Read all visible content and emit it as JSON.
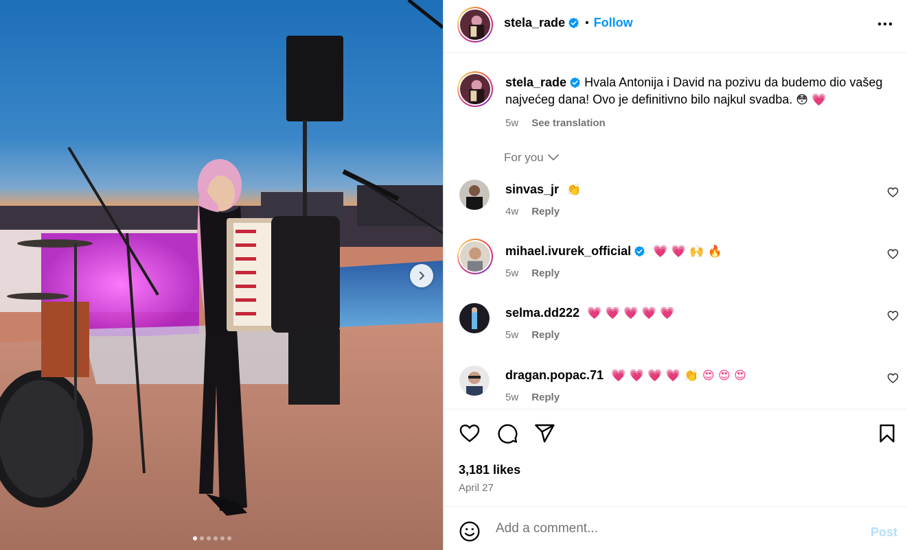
{
  "post": {
    "author": "stela_rade",
    "follow_label": "Follow",
    "separator": "•",
    "caption": "Hvala Antonija i David na pozivu da budemo dio vašeg najvećeg dana! Ovo je definitivno bilo najkul svadba.",
    "caption_emojis": "😳 💗",
    "caption_age": "5w",
    "see_translation": "See translation",
    "for_you": "For you",
    "likes": "3,181 likes",
    "date": "April 27",
    "carousel": {
      "slide_count": 6,
      "active_index": 0
    }
  },
  "comments": [
    {
      "user": "sinvas_jr",
      "verified": false,
      "text": "👏",
      "age": "4w",
      "reply": "Reply"
    },
    {
      "user": "mihael.ivurek_official",
      "verified": true,
      "text": "💗 💗 🙌 🔥",
      "age": "5w",
      "reply": "Reply"
    },
    {
      "user": "selma.dd222",
      "verified": false,
      "text": "💗 💗 💗 💗 💗",
      "age": "5w",
      "reply": "Reply"
    },
    {
      "user": "dragan.popac.71",
      "verified": false,
      "text": "💗 💗 💗 💗 👏 😍 😍 😍",
      "age": "5w",
      "reply": "Reply"
    }
  ],
  "add_comment": {
    "placeholder": "Add a comment...",
    "post_label": "Post"
  },
  "colors": {
    "accent": "#0095f6",
    "muted": "#737373",
    "post_disabled": "#b2dffc"
  }
}
